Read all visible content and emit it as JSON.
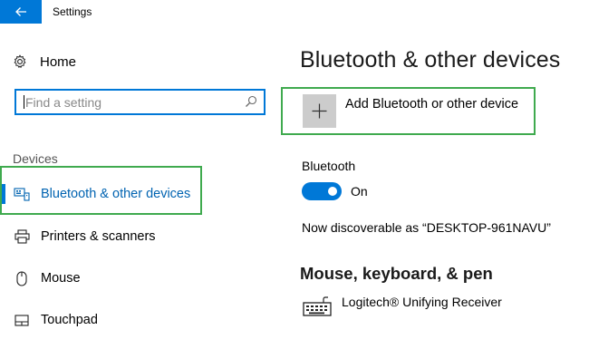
{
  "window": {
    "title": "Settings"
  },
  "sidebar": {
    "home_label": "Home",
    "search": {
      "placeholder": "Find a setting",
      "value": ""
    },
    "section_header": "Devices",
    "items": [
      {
        "label": "Bluetooth & other devices",
        "icon": "bluetooth-devices-icon",
        "selected": true
      },
      {
        "label": "Printers & scanners",
        "icon": "printer-icon",
        "selected": false
      },
      {
        "label": "Mouse",
        "icon": "mouse-icon",
        "selected": false
      },
      {
        "label": "Touchpad",
        "icon": "touchpad-icon",
        "selected": false
      }
    ]
  },
  "main": {
    "title": "Bluetooth & other devices",
    "add_device_label": "Add Bluetooth or other device",
    "bluetooth": {
      "label": "Bluetooth",
      "state": "On",
      "enabled": true
    },
    "discoverable_text": "Now discoverable as “DESKTOP-961NAVU”",
    "mkp_section": {
      "title": "Mouse, keyboard, & pen",
      "devices": [
        {
          "name": "Logitech® Unifying Receiver",
          "icon": "keyboard-icon"
        }
      ]
    }
  },
  "colors": {
    "accent": "#0078d7",
    "highlight_border": "#3faa4e",
    "add_tile": "#cccccc"
  }
}
